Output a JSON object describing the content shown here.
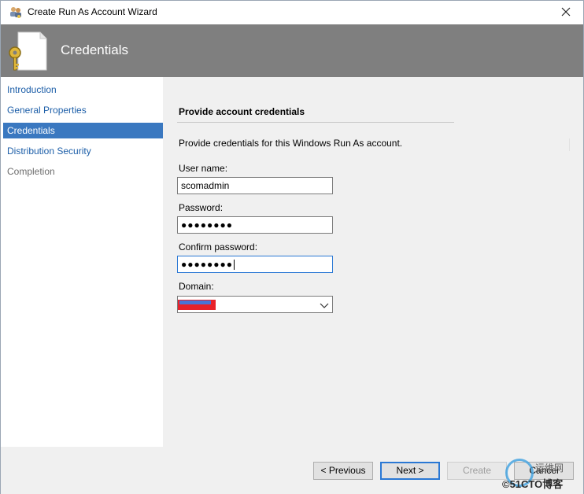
{
  "window": {
    "title": "Create Run As Account Wizard",
    "icon": "people-key-icon",
    "close_icon": "close-icon"
  },
  "banner": {
    "title": "Credentials",
    "icon": "document-key-icon"
  },
  "nav": {
    "items": [
      {
        "label": "Introduction",
        "state": "link"
      },
      {
        "label": "General Properties",
        "state": "link"
      },
      {
        "label": "Credentials",
        "state": "active"
      },
      {
        "label": "Distribution Security",
        "state": "link"
      },
      {
        "label": "Completion",
        "state": "disabled"
      }
    ]
  },
  "form": {
    "section_title": "Provide account credentials",
    "description": "Provide credentials for this Windows Run As account.",
    "username_label": "User name:",
    "username_value": "scomadmin",
    "password_label": "Password:",
    "password_value": "●●●●●●●●",
    "confirm_label": "Confirm password:",
    "confirm_value": "●●●●●●●●",
    "domain_label": "Domain:",
    "domain_redacted": true
  },
  "footer": {
    "previous_label": "< Previous",
    "next_label": "Next >",
    "create_label": "Create",
    "cancel_label": "Cancel"
  },
  "watermark": {
    "line1": "运维网",
    "line2": "©51CTO博客"
  },
  "colors": {
    "banner": "#7f7f7f",
    "nav_active": "#3a78c0",
    "link": "#1c5ea8",
    "focus_border": "#2a78d4",
    "redaction_red": "#e8222a",
    "redaction_blue": "#4a74d6"
  }
}
